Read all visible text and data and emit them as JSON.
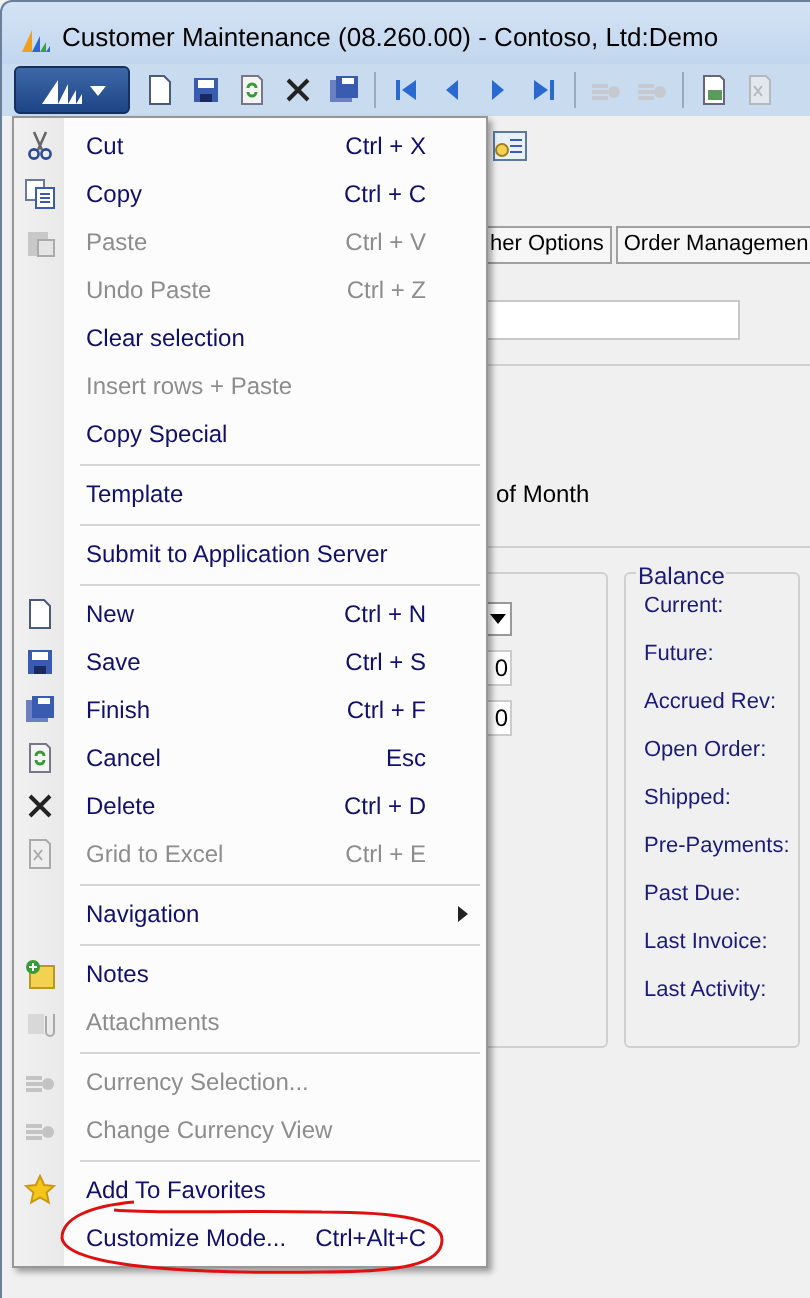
{
  "window": {
    "title": "Customer Maintenance (08.260.00) - Contoso, Ltd:Demo"
  },
  "toolbar": [
    {
      "kind": "new",
      "disabled": false
    },
    {
      "kind": "save",
      "disabled": false
    },
    {
      "kind": "refresh",
      "disabled": false
    },
    {
      "kind": "delete",
      "disabled": false
    },
    {
      "kind": "finish",
      "disabled": false
    },
    {
      "kind": "sep"
    },
    {
      "kind": "first",
      "disabled": false
    },
    {
      "kind": "prev",
      "disabled": false
    },
    {
      "kind": "next",
      "disabled": false
    },
    {
      "kind": "last",
      "disabled": false
    },
    {
      "kind": "sep"
    },
    {
      "kind": "currency",
      "disabled": true
    },
    {
      "kind": "currency",
      "disabled": true
    },
    {
      "kind": "sep"
    },
    {
      "kind": "report",
      "disabled": false
    },
    {
      "kind": "excel",
      "disabled": true
    }
  ],
  "tabs": [
    {
      "label": "her Options"
    },
    {
      "label": "Order Managemen"
    }
  ],
  "form": {
    "note": "of Month",
    "fields": [
      {
        "value": "0"
      },
      {
        "value": "0"
      }
    ]
  },
  "balance": {
    "title": "Balance",
    "labels": [
      "Current:",
      "Future:",
      "Accrued Rev:",
      "Open Order:",
      "Shipped:",
      "Pre-Payments:",
      "Past Due:",
      "Last Invoice:",
      "Last Activity:"
    ]
  },
  "menu": {
    "items": [
      {
        "kind": "item",
        "label": "Cut",
        "shortcut": "Ctrl + X",
        "disabled": false
      },
      {
        "kind": "item",
        "label": "Copy",
        "shortcut": "Ctrl + C",
        "disabled": false
      },
      {
        "kind": "item",
        "label": "Paste",
        "shortcut": "Ctrl + V",
        "disabled": true
      },
      {
        "kind": "item",
        "label": "Undo Paste",
        "shortcut": "Ctrl + Z",
        "disabled": true
      },
      {
        "kind": "item",
        "label": "Clear selection",
        "disabled": false
      },
      {
        "kind": "item",
        "label": "Insert rows + Paste",
        "disabled": true
      },
      {
        "kind": "item",
        "label": "Copy Special",
        "disabled": false
      },
      {
        "kind": "separator"
      },
      {
        "kind": "item",
        "label": "Template",
        "disabled": false
      },
      {
        "kind": "separator"
      },
      {
        "kind": "item",
        "label": "Submit to Application Server",
        "disabled": false
      },
      {
        "kind": "separator"
      },
      {
        "kind": "item",
        "label": "New",
        "shortcut": "Ctrl + N",
        "disabled": false
      },
      {
        "kind": "item",
        "label": "Save",
        "shortcut": "Ctrl + S",
        "disabled": false
      },
      {
        "kind": "item",
        "label": "Finish",
        "shortcut": "Ctrl + F",
        "disabled": false
      },
      {
        "kind": "item",
        "label": "Cancel",
        "shortcut": "Esc",
        "disabled": false
      },
      {
        "kind": "item",
        "label": "Delete",
        "shortcut": "Ctrl + D",
        "disabled": false
      },
      {
        "kind": "item",
        "label": "Grid to Excel",
        "shortcut": "Ctrl + E",
        "disabled": true
      },
      {
        "kind": "separator"
      },
      {
        "kind": "submenu",
        "label": "Navigation",
        "disabled": false
      },
      {
        "kind": "separator"
      },
      {
        "kind": "item",
        "label": "Notes",
        "disabled": false
      },
      {
        "kind": "item",
        "label": "Attachments",
        "disabled": true
      },
      {
        "kind": "separator"
      },
      {
        "kind": "item",
        "label": "Currency Selection...",
        "disabled": true
      },
      {
        "kind": "item",
        "label": "Change Currency View",
        "disabled": true
      },
      {
        "kind": "separator"
      },
      {
        "kind": "item",
        "label": "Add To Favorites",
        "disabled": false
      },
      {
        "kind": "item",
        "label": "Customize Mode...",
        "shortcut": "Ctrl+Alt+C",
        "disabled": false,
        "circled": true
      }
    ]
  }
}
